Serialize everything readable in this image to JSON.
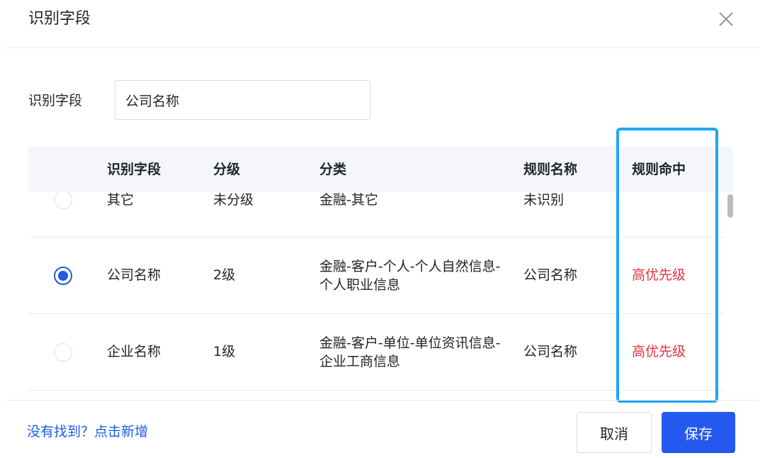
{
  "dialog": {
    "title": "识别字段"
  },
  "field": {
    "label": "识别字段",
    "value": "公司名称"
  },
  "table": {
    "columns": [
      "识别字段",
      "分级",
      "分类",
      "规则名称",
      "规则命中"
    ],
    "rows": [
      {
        "selected": false,
        "field": "其它",
        "level": "未分级",
        "category": "金融-其它",
        "rule": "未识别",
        "hit": ""
      },
      {
        "selected": true,
        "field": "公司名称",
        "level": "2级",
        "category": "金融-客户-个人-个人自然信息-个人职业信息",
        "rule": "公司名称",
        "hit": "高优先级"
      },
      {
        "selected": false,
        "field": "企业名称",
        "level": "1级",
        "category": "金融-客户-单位-单位资讯信息-企业工商信息",
        "rule": "公司名称",
        "hit": "高优先级"
      }
    ]
  },
  "footer": {
    "add_link": "没有找到？点击新增",
    "cancel_label": "取消",
    "save_label": "保存"
  },
  "colors": {
    "primary": "#2459f0",
    "hit_text": "#e0343f",
    "highlight_box": "#1ea7f2"
  },
  "icons": {
    "close": "close-icon"
  }
}
